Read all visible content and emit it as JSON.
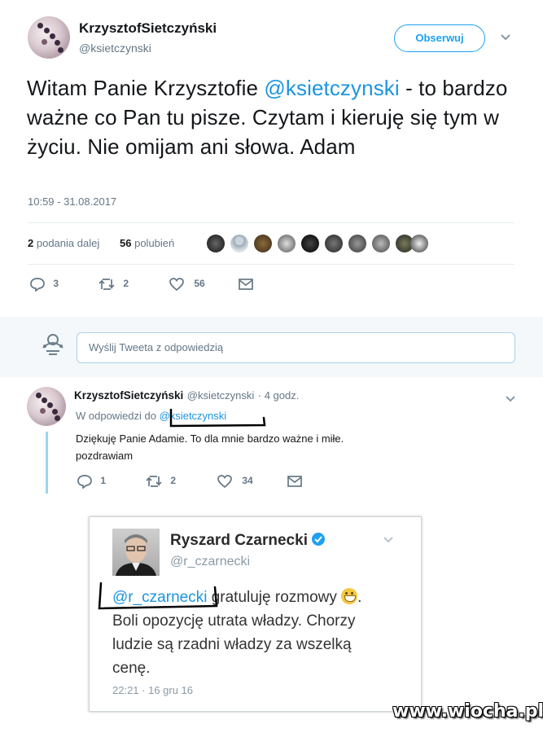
{
  "main_tweet": {
    "display_name": "KrzysztofSietczyński",
    "handle": "@ksietczynski",
    "follow_label": "Obserwuj",
    "text_before": "Witam Panie Krzysztofie ",
    "text_mention": "@ksietczynski",
    "text_after": " - to bardzo ważne co Pan tu pisze. Czytam i kieruję się tym w życiu. Nie omijam ani słowa. Adam",
    "timestamp": "10:59 - 31.08.2017",
    "retweets_count": "2",
    "retweets_label": "podania dalej",
    "likes_count": "56",
    "likes_label": "polubień",
    "actions": {
      "replies": "3",
      "retweets": "2",
      "likes": "56"
    }
  },
  "reply_composer": {
    "placeholder": "Wyślij Tweeta z odpowiedzią"
  },
  "reply_tweet": {
    "display_name": "KrzysztofSietczyński",
    "handle": "@ksietczynski",
    "time": "· 4 godz.",
    "in_reply_prefix": "W odpowiedzi do ",
    "in_reply_mention": "@ksietczynski",
    "text_line1": "Dziękuję Panie Adamie. To dla mnie bardzo ważne i miłe.",
    "text_line2": "pozdrawiam",
    "actions": {
      "replies": "1",
      "retweets": "2",
      "likes": "34"
    }
  },
  "embedded_tweet": {
    "display_name": "Ryszard Czarnecki",
    "handle": "@r_czarnecki",
    "mention": "@r_czarnecki",
    "line1_after": " gratuluję rozmowy ",
    "line2": "Boli opozycję utrata władzy. Chorzy",
    "line3": "ludzie są rzadni władzy za wszelką",
    "line4": "cenę.",
    "timestamp": "22:21 · 16 gru 16"
  },
  "watermark": "www.wiocha.pl",
  "colors": {
    "accent": "#1da1f2",
    "mention": "#1b95e0",
    "like": "#e0245e"
  }
}
